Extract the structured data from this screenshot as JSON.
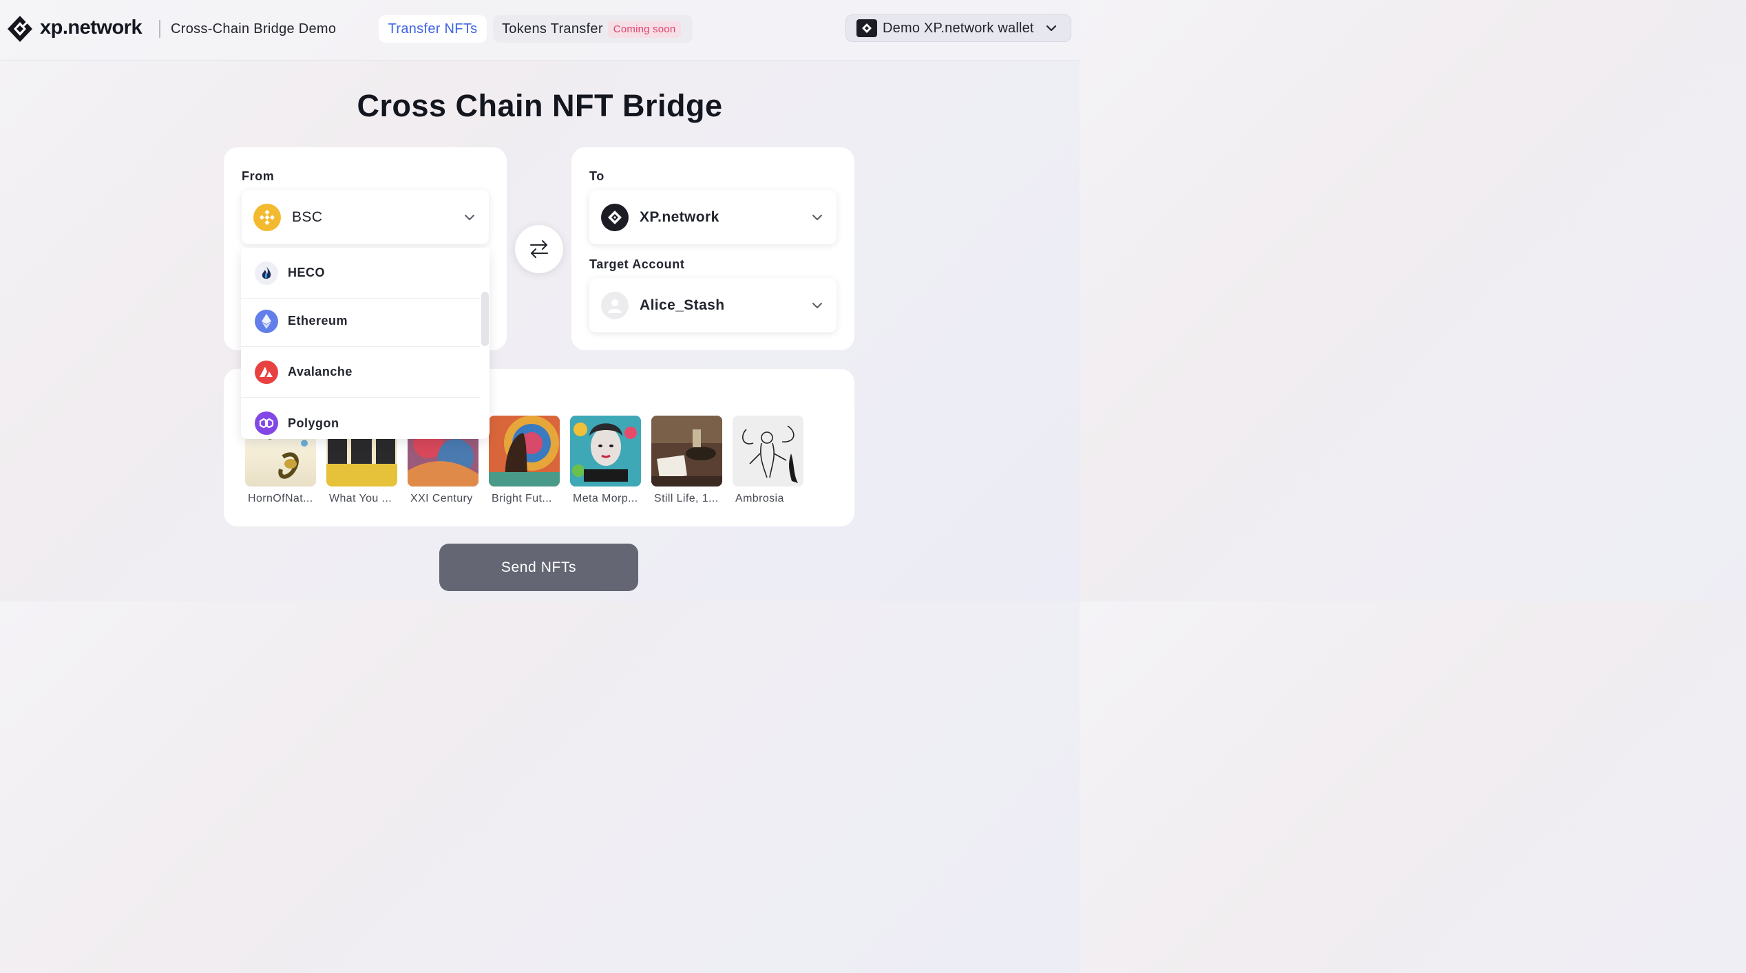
{
  "header": {
    "brand": "xp.network",
    "subtitle": "Cross-Chain Bridge Demo",
    "tabs": {
      "transfer_nfts": "Transfer NFTs",
      "tokens_transfer": "Tokens Transfer",
      "coming_soon_badge": "Coming soon"
    },
    "wallet_label": "Demo XP.network wallet"
  },
  "page_title": "Cross Chain NFT Bridge",
  "from": {
    "label": "From",
    "selected_chain": "BSC",
    "dropdown_options": [
      "HECO",
      "Ethereum",
      "Avalanche",
      "Polygon"
    ]
  },
  "to": {
    "label": "To",
    "selected_chain": "XP.network",
    "target_account_label": "Target Account",
    "target_account": "Alice_Stash"
  },
  "nfts": [
    {
      "name": "HornOfNat..."
    },
    {
      "name": "What You ..."
    },
    {
      "name": "XXI Century"
    },
    {
      "name": "Bright Fut..."
    },
    {
      "name": "Meta Morp..."
    },
    {
      "name": "Still Life, 1..."
    },
    {
      "name": "Ambrosia"
    }
  ],
  "send_button": "Send NFTs",
  "colors": {
    "accent_blue": "#3e64e3",
    "badge_pink": "#e0426e",
    "bsc_yellow": "#f3ba2f",
    "ethereum_purple": "#627eea",
    "avalanche_red": "#e84142",
    "polygon_purple": "#8247e5",
    "send_button_gray": "#646673"
  }
}
